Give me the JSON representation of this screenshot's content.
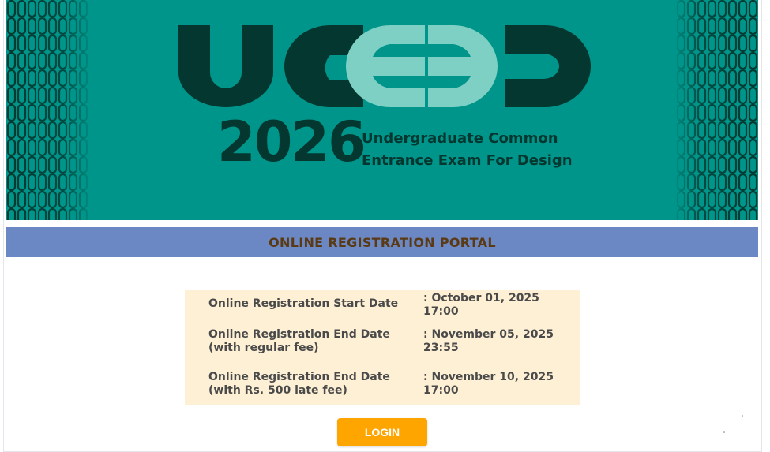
{
  "banner": {
    "logo_text": "UCEED",
    "year": "2026",
    "tagline_line1": "Undergraduate Common",
    "tagline_line2": "Entrance Exam For Design"
  },
  "portal": {
    "title": "ONLINE REGISTRATION PORTAL"
  },
  "schedule": [
    {
      "label": "Online Registration Start Date",
      "label2": "",
      "value": ": October 01, 2025",
      "value2": "17:00"
    },
    {
      "label": "Online Registration End Date",
      "label2": "(with regular fee)",
      "value": ": November 05, 2025",
      "value2": "23:55"
    },
    {
      "label": "Online Registration End Date",
      "label2": "(with Rs. 500 late fee)",
      "value": ": November 10, 2025",
      "value2": "17:00"
    }
  ],
  "actions": {
    "login_label": "LOGIN"
  },
  "colors": {
    "banner_bg": "#00958a",
    "logo_dark": "#04372f",
    "logo_light": "#7ecfc4",
    "portal_bar": "#6b88c4",
    "portal_title": "#5a3a14",
    "dates_bg": "#fdf0d5",
    "login_bg": "#ffa500"
  }
}
